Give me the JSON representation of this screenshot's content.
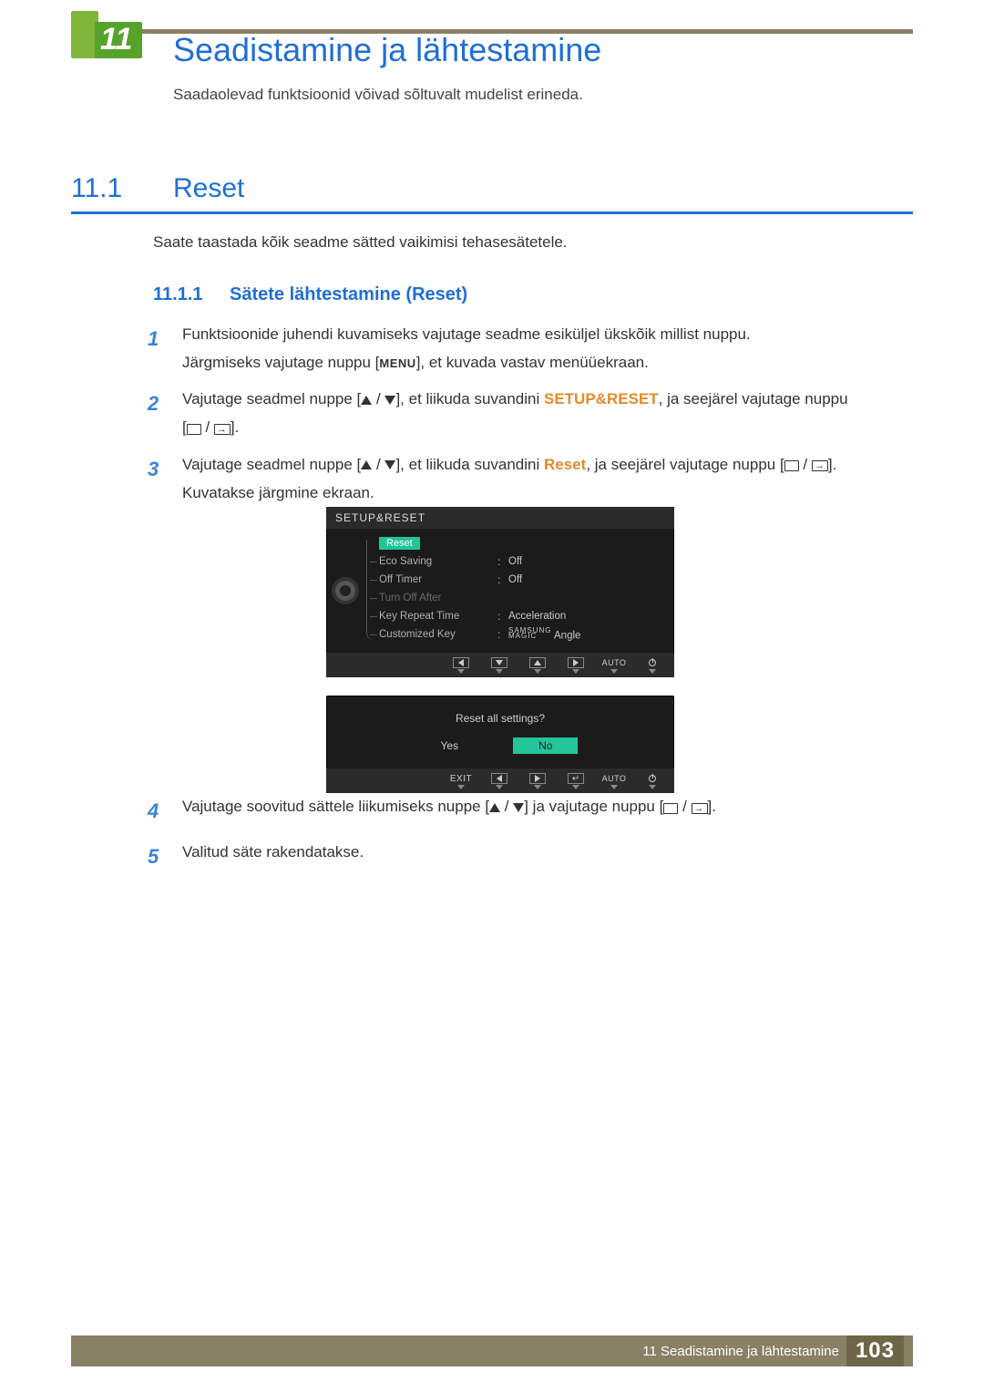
{
  "chapter": {
    "number": "11",
    "title": "Seadistamine ja lähtestamine",
    "intro": "Saadaolevad funktsioonid võivad sõltuvalt mudelist erineda."
  },
  "section": {
    "number": "11.1",
    "title": "Reset",
    "desc": "Saate taastada kõik seadme sätted vaikimisi tehasesätetele."
  },
  "subsection": {
    "number": "11.1.1",
    "title": "Sätete lähtestamine (Reset)"
  },
  "steps": {
    "s1a": "Funktsioonide juhendi kuvamiseks vajutage seadme esiküljel ükskõik millist nuppu.",
    "s1b_pre": "Järgmiseks vajutage nuppu [",
    "s1b_menu": "MENU",
    "s1b_post": "], et kuvada vastav menüüekraan.",
    "s2_pre": "Vajutage seadmel nuppe [",
    "s2_mid": "], et liikuda suvandini ",
    "s2_link": "SETUP&RESET",
    "s2_post": ", ja seejärel vajutage nuppu",
    "s2_end": "[",
    "s2_end2": "].",
    "s3_pre": "Vajutage seadmel nuppe [",
    "s3_mid": "], et liikuda suvandini ",
    "s3_link": "Reset",
    "s3_post": ", ja seejärel vajutage nuppu [",
    "s3_end": "].",
    "s3_line2": "Kuvatakse järgmine ekraan.",
    "s4_pre": "Vajutage soovitud sättele liikumiseks nuppe [",
    "s4_mid": "] ja vajutage nuppu [",
    "s4_end": "].",
    "s5": "Valitud säte rakendatakse.",
    "n1": "1",
    "n2": "2",
    "n3": "3",
    "n4": "4",
    "n5": "5"
  },
  "osd1": {
    "header": "SETUP&RESET",
    "rows": [
      {
        "label": "Reset",
        "hl": true
      },
      {
        "label": "Eco Saving",
        "val": "Off"
      },
      {
        "label": "Off Timer",
        "val": "Off"
      },
      {
        "label": "Turn Off After",
        "dim": true
      },
      {
        "label": "Key Repeat Time",
        "val": "Acceleration"
      },
      {
        "label": "Customized Key",
        "val": "Angle",
        "magic": "SAMSUNG\nMAGIC"
      }
    ],
    "nav_auto": "AUTO"
  },
  "osd2": {
    "question": "Reset all settings?",
    "yes": "Yes",
    "no": "No",
    "nav_exit": "EXIT",
    "nav_auto": "AUTO"
  },
  "footer": {
    "text": "11 Seadistamine ja lähtestamine",
    "page": "103"
  }
}
